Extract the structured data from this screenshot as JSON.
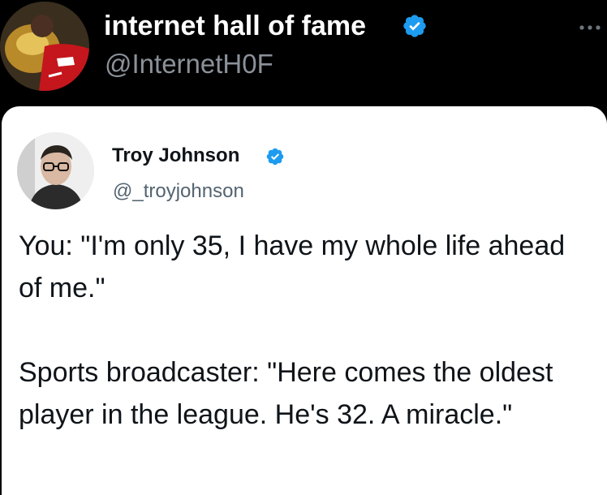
{
  "retweeter": {
    "display_name": "internet hall of fame",
    "handle": "@InternetH0F",
    "verified_color": "#1d9bf0",
    "avatar": "jersey-player-trophy-avatar",
    "more_icon": "ellipsis-icon"
  },
  "quoted_tweet": {
    "display_name": "Troy Johnson",
    "handle": "@_troyjohnson",
    "verified_color": "#1d9bf0",
    "avatar": "man-with-glasses-avatar",
    "text": "You: \"I'm only 35, I have my whole life ahead of me.\"\n\nSports broadcaster: \"Here comes the oldest player in the league. He's 32. A miracle.\""
  }
}
